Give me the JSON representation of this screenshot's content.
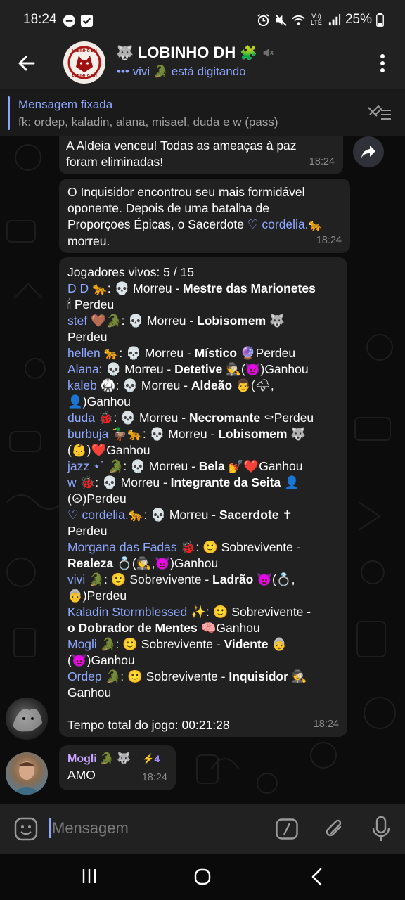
{
  "status_bar": {
    "time": "18:24",
    "battery": "25%",
    "signal_label": "Vo) LTE"
  },
  "header": {
    "back_icon": "arrow-left-icon",
    "avatar_text_top": "LOBINHO DH",
    "avatar_text_bottom": "LOBINHO DH",
    "title": "LOBINHO DH",
    "title_prefix_emoji": "🐺",
    "title_suffix_emoji": "🧩",
    "subtitle": "••• vivi 🐊 está digitando"
  },
  "pinned": {
    "title": "Mensagem fixada",
    "text": "fk: ordep, kaladin, alana, misael, duda e w (pass)"
  },
  "messages": {
    "m1": {
      "lines": [
        "A Aldeia venceu! Todas as ameaças à paz",
        "foram eliminadas!"
      ],
      "time": "18:24"
    },
    "m2": {
      "line1": "O Inquisidor encontrou seu mais formidável",
      "line2": "oponente. Depois de uma batalha de",
      "line3_a": "Proporçoes Épicas, o Sacerdote ",
      "line3_name": "♡ cordelia.",
      "line3_emoji": "🐆",
      "line4": "morreu.",
      "time": "18:24"
    },
    "m3": {
      "header": "Jogadores vivos: 5 / 15",
      "footer": "Tempo total do jogo: 00:21:28",
      "time": "18:24"
    },
    "m4": {
      "sender": "Mogli",
      "sender_emoji": "🐊 🐺",
      "boost": "⚡4",
      "text": "AMO",
      "time": "18:24"
    }
  },
  "players": [
    {
      "l1": [
        [
          "n",
          "D D 🐆"
        ],
        [
          "t",
          ": 💀 Morreu - "
        ],
        [
          "b",
          "Mestre das Marionetes"
        ]
      ],
      "l2": [
        [
          "t",
          "🕯 Perdeu"
        ]
      ]
    },
    {
      "l1": [
        [
          "n",
          "stef 🤎🐊"
        ],
        [
          "t",
          ": 💀 Morreu - "
        ],
        [
          "b",
          "Lobisomem"
        ],
        [
          "t",
          " 🐺"
        ]
      ],
      "l2": [
        [
          "t",
          "Perdeu"
        ]
      ]
    },
    {
      "l1": [
        [
          "n",
          "hellen 🐆"
        ],
        [
          "t",
          ": 💀 Morreu - "
        ],
        [
          "b",
          "Místico"
        ],
        [
          "t",
          " 🔮Perdeu"
        ]
      ]
    },
    {
      "l1": [
        [
          "n",
          "Alana"
        ],
        [
          "t",
          ": 💀 Morreu - "
        ],
        [
          "b",
          "Detetive"
        ],
        [
          "t",
          " 🕵(😈)Ganhou"
        ]
      ]
    },
    {
      "l1": [
        [
          "n",
          "kaleb 🥋"
        ],
        [
          "t",
          ": 💀 Morreu - "
        ],
        [
          "b",
          "Aldeão"
        ],
        [
          "t",
          " 👨(🌩,"
        ]
      ],
      "l2": [
        [
          "t",
          "👤)Ganhou"
        ]
      ]
    },
    {
      "l1": [
        [
          "n",
          "duda 🐞"
        ],
        [
          "t",
          ": 💀 Morreu - "
        ],
        [
          "b",
          "Necromante"
        ],
        [
          "t",
          " ⚰Perdeu"
        ]
      ]
    },
    {
      "l1": [
        [
          "n",
          "burbuja 🦆🐆"
        ],
        [
          "t",
          ": 💀 Morreu - "
        ],
        [
          "b",
          "Lobisomem"
        ],
        [
          "t",
          " 🐺"
        ]
      ],
      "l2": [
        [
          "t",
          "(👶)❤️Ganhou"
        ]
      ]
    },
    {
      "l1": [
        [
          "n",
          "jazz ⋆˙ 🐊"
        ],
        [
          "t",
          ": 💀 Morreu - "
        ],
        [
          "b",
          "Bela"
        ],
        [
          "t",
          " 💅❤️Ganhou"
        ]
      ]
    },
    {
      "l1": [
        [
          "n",
          "w 🐞"
        ],
        [
          "t",
          ": 💀 Morreu - "
        ],
        [
          "b",
          "Integrante da Seita"
        ],
        [
          "t",
          " 👤"
        ]
      ],
      "l2": [
        [
          "t",
          "(☮)Perdeu"
        ]
      ]
    },
    {
      "l1": [
        [
          "n",
          "♡ cordelia.🐆"
        ],
        [
          "t",
          ": 💀 Morreu - "
        ],
        [
          "b",
          "Sacerdote"
        ],
        [
          "t",
          " ✝"
        ]
      ],
      "l2": [
        [
          "t",
          "Perdeu"
        ]
      ]
    },
    {
      "l1": [
        [
          "n",
          "Morgana das Fadas 🐞"
        ],
        [
          "t",
          ": 🙂 Sobrevivente -"
        ]
      ],
      "l2": [
        [
          "b",
          "Realeza"
        ],
        [
          "t",
          " 💍(🕵,😈)Ganhou"
        ]
      ]
    },
    {
      "l1": [
        [
          "n",
          "vivi 🐊"
        ],
        [
          "t",
          ": 🙂 Sobrevivente - "
        ],
        [
          "b",
          "Ladrão"
        ],
        [
          "t",
          " 😈(💍,"
        ]
      ],
      "l2": [
        [
          "t",
          "👵)Perdeu"
        ]
      ]
    },
    {
      "l1": [
        [
          "n",
          "Kaladin Stormblessed ✨"
        ],
        [
          "t",
          ": 🙂 Sobrevivente -"
        ]
      ],
      "l2": [
        [
          "b",
          "o Dobrador de Mentes"
        ],
        [
          "t",
          " 🧠Ganhou"
        ]
      ]
    },
    {
      "l1": [
        [
          "n",
          "Mogli 🐊"
        ],
        [
          "t",
          ": 🙂 Sobrevivente - "
        ],
        [
          "b",
          "Vidente"
        ],
        [
          "t",
          " 👵"
        ]
      ],
      "l2": [
        [
          "t",
          "(😈)Ganhou"
        ]
      ]
    },
    {
      "l1": [
        [
          "n",
          "Ordep 🐊"
        ],
        [
          "t",
          ": 🙂 Sobrevivente - "
        ],
        [
          "b",
          "Inquisidor"
        ],
        [
          "t",
          " 🕵"
        ]
      ],
      "l2": [
        [
          "t",
          "Ganhou"
        ]
      ]
    }
  ],
  "composer": {
    "placeholder": "Mensagem"
  },
  "icons": {
    "accent": "#8fa8ff",
    "bubble": "#212121",
    "bar": "#212121"
  }
}
